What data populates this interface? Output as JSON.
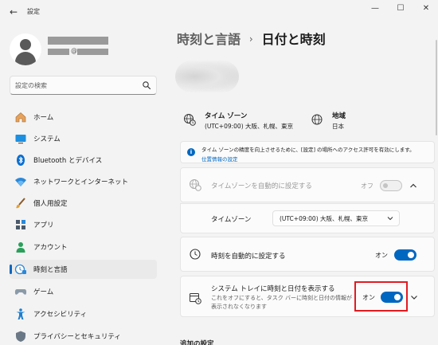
{
  "window": {
    "app_title": "設定",
    "minimize_icon": "—",
    "maximize_icon": "☐",
    "close_icon": "✕",
    "back_icon": "←"
  },
  "profile": {
    "email_at": "@"
  },
  "search": {
    "placeholder": "設定の検索"
  },
  "nav": {
    "items": [
      {
        "label": "ホーム",
        "icon": "home-icon"
      },
      {
        "label": "システム",
        "icon": "system-icon"
      },
      {
        "label": "Bluetooth とデバイス",
        "icon": "bluetooth-icon"
      },
      {
        "label": "ネットワークとインターネット",
        "icon": "wifi-icon"
      },
      {
        "label": "個人用設定",
        "icon": "brush-icon"
      },
      {
        "label": "アプリ",
        "icon": "apps-icon"
      },
      {
        "label": "アカウント",
        "icon": "account-icon"
      },
      {
        "label": "時刻と言語",
        "icon": "time-language-icon",
        "selected": true
      },
      {
        "label": "ゲーム",
        "icon": "gamepad-icon"
      },
      {
        "label": "アクセシビリティ",
        "icon": "accessibility-icon"
      },
      {
        "label": "プライバシーとセキュリティ",
        "icon": "shield-icon"
      }
    ]
  },
  "breadcrumb": {
    "parent": "時刻と言語",
    "separator": "›",
    "current": "日付と時刻"
  },
  "summary": {
    "timezone_title": "タイム ゾーン",
    "timezone_value": "(UTC+09:00) 大阪、札幌、東京",
    "region_title": "地域",
    "region_value": "日本"
  },
  "notice": {
    "text": "タイム ゾーンの精度を向上させるために、[設定] の場所へのアクセス許可を有効にします。",
    "link": "位置情報の設定"
  },
  "settings": {
    "auto_timezone": {
      "label": "タイムゾーンを自動的に設定する",
      "state": "オフ"
    },
    "timezone": {
      "label": "タイムゾーン",
      "value": "(UTC+09:00) 大阪、札幌、東京"
    },
    "auto_time": {
      "label": "時刻を自動的に設定する",
      "state": "オン"
    },
    "tray": {
      "label": "システム トレイに時刻と日付を表示する",
      "sub1": "これをオフにすると、タスク バーに時刻と日付の情報が",
      "sub2": "表示されなくなります",
      "state": "オン"
    }
  },
  "additional": {
    "heading": "追加の設定"
  },
  "colors": {
    "accent": "#0067c0",
    "highlight": "#e11b22"
  }
}
